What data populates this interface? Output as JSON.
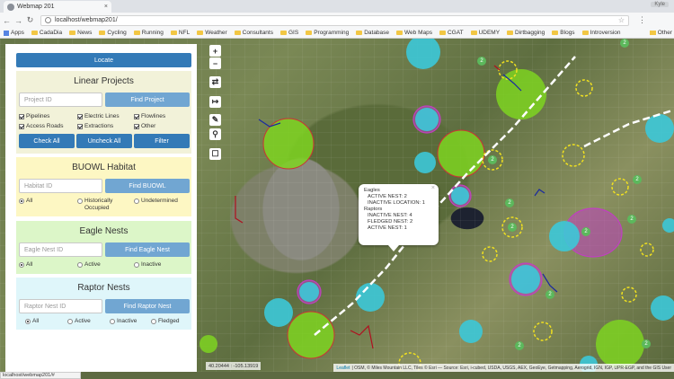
{
  "browser": {
    "tab_title": "Webmap 201",
    "profile": "Kyle",
    "url": "localhost/webmap201/",
    "bookmarks": [
      "Apps",
      "CadaDia",
      "News",
      "Cycling",
      "Running",
      "NFL",
      "Weather",
      "Consultants",
      "GIS",
      "Programming",
      "Database",
      "Web Maps",
      "CGAT",
      "UDEMY",
      "Dirtbagging",
      "Blogs",
      "Introversion"
    ],
    "other_bookmarks": "Other"
  },
  "panel": {
    "locate_label": "Locate",
    "linear": {
      "title": "Linear Projects",
      "placeholder": "Project ID",
      "find_label": "Find Project",
      "checkboxes": [
        "Pipelines",
        "Electric Lines",
        "Flowlines",
        "Access Roads",
        "Extractions",
        "Other"
      ],
      "check_all": "Check All",
      "uncheck_all": "Uncheck All",
      "filter": "Filter"
    },
    "buowl": {
      "title": "BUOWL Habitat",
      "placeholder": "Habitat ID",
      "find_label": "Find BUOWL",
      "radios": [
        "All",
        "Historically",
        "Occupied",
        "Undetermined"
      ]
    },
    "eagle": {
      "title": "Eagle Nests",
      "placeholder": "Eagle Nest ID",
      "find_label": "Find Eagle Nest",
      "radios": [
        "All",
        "Active",
        "Inactive"
      ]
    },
    "raptor": {
      "title": "Raptor Nests",
      "placeholder": "Raptor Nest ID",
      "find_label": "Find Raptor Nest",
      "radios": [
        "All",
        "Active",
        "Inactive",
        "Fledged"
      ]
    }
  },
  "map": {
    "controls": [
      "+",
      "−",
      "⇄",
      "↦",
      "✎",
      "⚲",
      "☐"
    ],
    "popup": {
      "close": "×",
      "line1": "Eagles",
      "line2": "ACTIVE NEST: 2",
      "line3": "INACTIVE LOCATION: 1",
      "line4": "Raptors",
      "line5": "INACTIVE NEST: 4",
      "line6": "FLEDGED NEST: 2",
      "line7": "ACTIVE NEST: 1"
    },
    "coords": "40.20444 : -105.13919",
    "attribution_link1": "Leaflet",
    "attribution_text": "| OSM, © Miles Mountain LLC, Tiles © Esri — Source: Esri, i-cubed, USDA, USGS, AEX, GeoEye, Getmapping, Aerogrid, IGN, IGP, UPR-EGP, and the GIS User",
    "cluster_labels": [
      "2",
      "2",
      "2",
      "2",
      "2",
      "2",
      "2",
      "2",
      "2",
      "2",
      "2"
    ],
    "colors": {
      "green_zone": "#7ed321",
      "cyan_nest": "#3cc8d8",
      "magenta_zone": "#c040c0",
      "yellow_dash": "#f0e020",
      "route_line": "#ffffff"
    }
  },
  "status_bar": "localhost/webmap201/#"
}
